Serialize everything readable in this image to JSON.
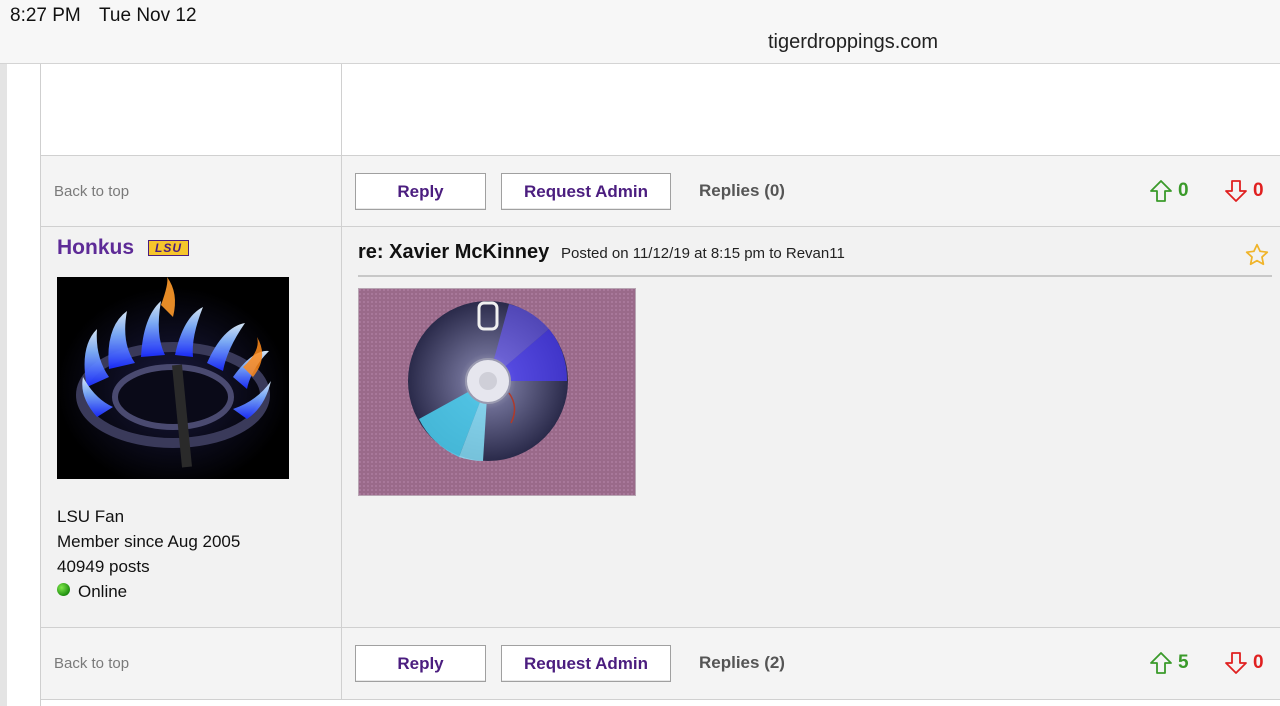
{
  "status_bar": {
    "time": "8:27 PM",
    "date": "Tue Nov 12"
  },
  "browser": {
    "url": "tigerdroppings.com"
  },
  "actions_top": {
    "back_to_top": "Back to top",
    "reply": "Reply",
    "request_admin": "Request Admin",
    "replies": "Replies (0)",
    "upvotes": "0",
    "downvotes": "0"
  },
  "post": {
    "username": "Honkus",
    "badge": "LSU",
    "user_info": {
      "fan": "LSU Fan",
      "member_since": "Member since Aug 2005",
      "posts": "40949 posts",
      "status": "Online"
    },
    "title": "re: Xavier McKinney",
    "meta": "Posted on 11/12/19 at 8:15 pm to Revan11"
  },
  "actions_bottom": {
    "back_to_top": "Back to top",
    "reply": "Reply",
    "request_admin": "Request Admin",
    "replies": "Replies (2)",
    "upvotes": "5",
    "downvotes": "0"
  },
  "colors": {
    "username": "#5e2b97",
    "button_text": "#4b1d7f",
    "upvote": "#3a9a2a",
    "downvote": "#e02020",
    "star": "#f0b429"
  },
  "icons": {
    "upvote": "arrow-up-outline-icon",
    "downvote": "arrow-down-outline-icon",
    "bookmark": "star-outline-icon",
    "online": "online-dot-icon"
  }
}
